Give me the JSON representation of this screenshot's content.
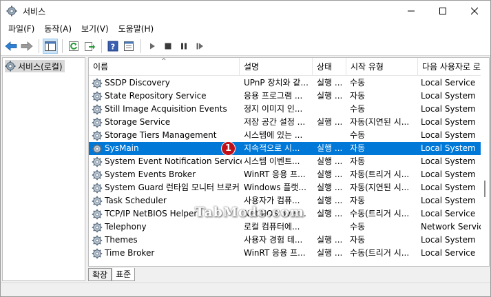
{
  "window": {
    "title": "서비스",
    "colors": {
      "selection": "#0078d7",
      "badge": "#c0101a"
    }
  },
  "menu": {
    "items": [
      "파일(F)",
      "동작(A)",
      "보기(V)",
      "도움말(H)"
    ]
  },
  "toolbar": {
    "icons": [
      "back-arrow-icon",
      "forward-arrow-icon",
      "show-tree-icon",
      "refresh-icon",
      "export-icon",
      "help-icon",
      "properties-icon",
      "play-icon",
      "stop-icon",
      "pause-icon",
      "restart-icon"
    ]
  },
  "tree": {
    "root_label": "서비스(로컬)"
  },
  "table": {
    "columns": [
      "이름",
      "설명",
      "상태",
      "시작 유형",
      "다음 사용자로 로"
    ],
    "rows": [
      {
        "name": "SSDP Discovery",
        "desc": "UPnP 장치와 같...",
        "status": "실행 ...",
        "type": "수동",
        "logon": "Local Service"
      },
      {
        "name": "State Repository Service",
        "desc": "응용 프로그램 ...",
        "status": "실행 ...",
        "type": "자동",
        "logon": "Local System"
      },
      {
        "name": "Still Image Acquisition Events",
        "desc": "정지 이미지 인...",
        "status": "",
        "type": "수동",
        "logon": "Local System"
      },
      {
        "name": "Storage Service",
        "desc": "저장 공간 설정 ...",
        "status": "실행 ...",
        "type": "자동(지연된 시...",
        "logon": "Local System"
      },
      {
        "name": "Storage Tiers Management",
        "desc": "시스템에 있는 ...",
        "status": "",
        "type": "수동",
        "logon": "Local System"
      },
      {
        "name": "SysMain",
        "desc": "지속적으로 시...",
        "status": "실행 ...",
        "type": "자동",
        "logon": "Local System"
      },
      {
        "name": "System Event Notification Service",
        "desc": "시스템 이벤트...",
        "status": "실행 ...",
        "type": "자동",
        "logon": "Local System"
      },
      {
        "name": "System Events Broker",
        "desc": "WinRT 응용 프...",
        "status": "실행 ...",
        "type": "자동(트리거 시...",
        "logon": "Local System"
      },
      {
        "name": "System Guard 런타임 모니터 브로커",
        "desc": "Windows 플랫...",
        "status": "실행 ...",
        "type": "자동(지연된 시...",
        "logon": "Local System"
      },
      {
        "name": "Task Scheduler",
        "desc": "사용자가 컴퓨...",
        "status": "실행 ...",
        "type": "자동",
        "logon": "Local System"
      },
      {
        "name": "TCP/IP NetBIOS Helper",
        "desc": "NetBIOS over...",
        "status": "실행 ...",
        "type": "수동(트리거 시...",
        "logon": "Local Service"
      },
      {
        "name": "Telephony",
        "desc": "로컬 컴퓨터에...",
        "status": "",
        "type": "수동",
        "logon": "Network Service"
      },
      {
        "name": "Themes",
        "desc": "사용자 경험 테...",
        "status": "실행 ...",
        "type": "자동",
        "logon": "Local System"
      },
      {
        "name": "Time Broker",
        "desc": "WinRT 응용 프...",
        "status": "실행 ...",
        "type": "수동(트리거 시...",
        "logon": "Local Service"
      }
    ]
  },
  "tabs": [
    "확장",
    "표준"
  ],
  "annotation": {
    "badge": "1",
    "watermark": "TabMode.com"
  }
}
